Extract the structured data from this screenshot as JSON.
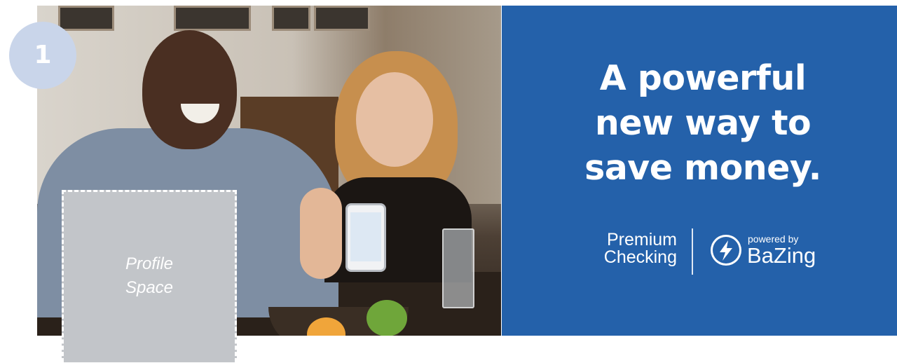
{
  "step_badge": {
    "number": "1"
  },
  "banner": {
    "headline_lines": [
      "A powerful",
      "new way to",
      "save money."
    ],
    "product_line1": "Premium",
    "product_line2": "Checking",
    "powered_by": "powered by",
    "brand_name": "BaZing",
    "panel_color": "#2461aa"
  },
  "profile_placeholder": {
    "line1": "Profile",
    "line2": "Space"
  }
}
